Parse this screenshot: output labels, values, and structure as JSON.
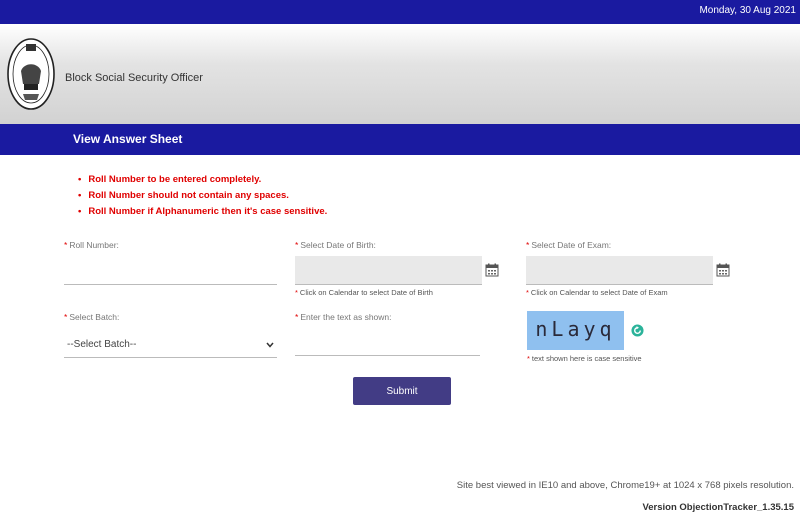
{
  "topbar": {
    "date": "Monday, 30 Aug 2021"
  },
  "header": {
    "org_name": "Block Social Security Officer",
    "logo_icon": "state-emblem-icon"
  },
  "page": {
    "title": "View Answer Sheet"
  },
  "instructions": [
    "Roll Number to be entered completely.",
    "Roll Number should not contain any spaces.",
    "Roll Number if Alphanumeric then it's case sensitive."
  ],
  "form": {
    "roll_number": {
      "label": "Roll Number:",
      "value": ""
    },
    "dob": {
      "label": "Select Date of Birth:",
      "hint": "Click on Calendar to select Date of Birth",
      "value": "",
      "icon": "calendar-icon"
    },
    "exam_date": {
      "label": "Select Date of Exam:",
      "hint": "Click on Calendar to select Date of Exam",
      "value": "",
      "icon": "calendar-icon"
    },
    "batch": {
      "label": "Select Batch:",
      "selected": "--Select Batch--"
    },
    "captcha_input": {
      "label": "Enter the text as shown:",
      "value": ""
    },
    "captcha": {
      "text": "nLayq",
      "hint": "text shown here is case sensitive",
      "refresh_icon": "refresh-icon"
    },
    "submit_label": "Submit"
  },
  "footer": {
    "browser_note": "Site best viewed in IE10 and above, Chrome19+ at 1024 x 768 pixels resolution.",
    "version": "Version ObjectionTracker_1.35.15"
  },
  "colors": {
    "nav_blue": "#1a1aa0",
    "alert_red": "#e00000",
    "submit_purple": "#423c85",
    "captcha_blue": "#8fc0ef"
  }
}
